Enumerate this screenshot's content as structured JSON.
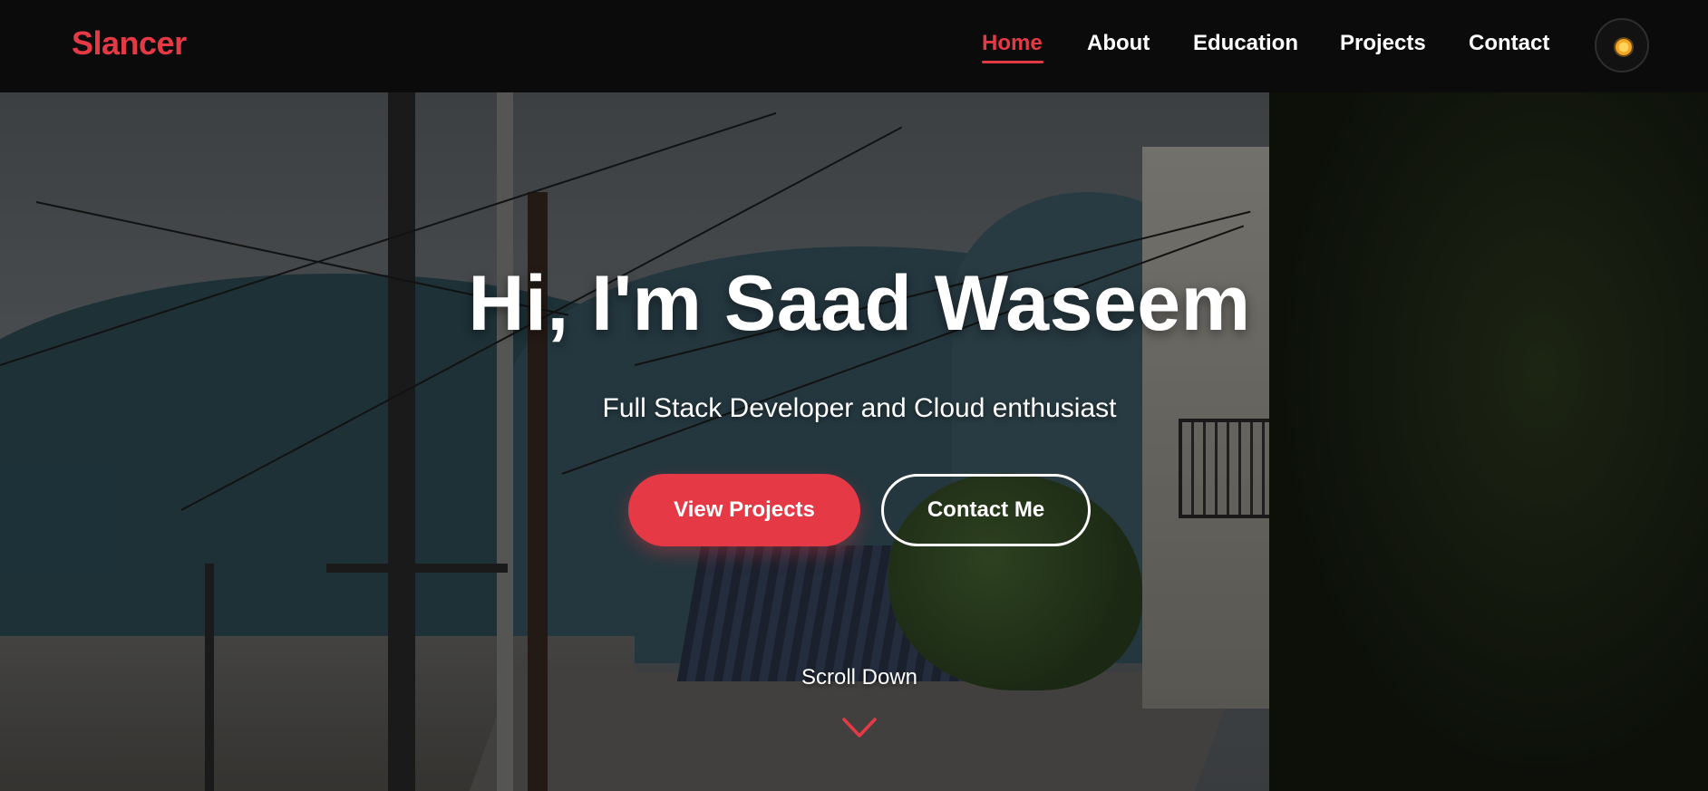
{
  "brand": {
    "logo": "Slancer"
  },
  "nav": {
    "links": [
      {
        "label": "Home",
        "active": true
      },
      {
        "label": "About",
        "active": false
      },
      {
        "label": "Education",
        "active": false
      },
      {
        "label": "Projects",
        "active": false
      },
      {
        "label": "Contact",
        "active": false
      }
    ],
    "theme_toggle_icon": "sun-icon"
  },
  "hero": {
    "title": "Hi, I'm Saad Waseem",
    "subtitle": "Full Stack Developer and Cloud enthusiast",
    "primary_button": "View Projects",
    "secondary_button": "Contact Me",
    "scroll_label": "Scroll Down",
    "scroll_icon": "chevron-down-icon"
  },
  "colors": {
    "accent": "#e63946",
    "navbar_bg": "#0b0b0b",
    "text": "#ffffff"
  }
}
